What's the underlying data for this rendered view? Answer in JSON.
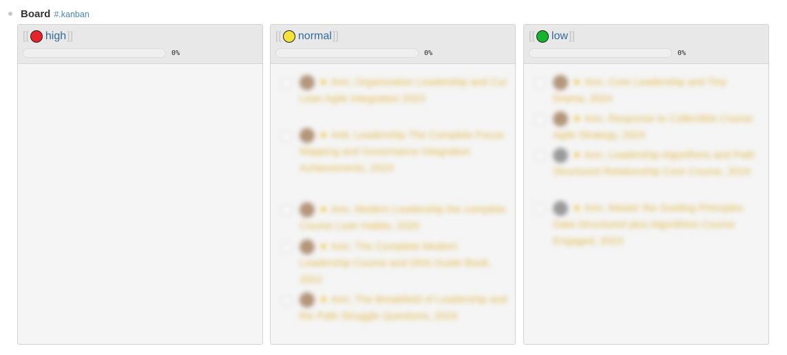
{
  "page": {
    "title": "Board",
    "tag": "#.kanban"
  },
  "columns": [
    {
      "name": "high",
      "bracket_open": "[[",
      "bracket_close": "]]",
      "dot_color": "#e8212b",
      "progress_percent": 0,
      "progress_label": "0%",
      "cards": []
    },
    {
      "name": "normal",
      "bracket_open": "[[",
      "bracket_close": "]]",
      "dot_color": "#f5e33a",
      "progress_percent": 0,
      "progress_label": "0%",
      "cards": [
        {
          "avatar": "avatar",
          "star": "★",
          "text": "Ann, Organization Leadership and Cur Lean Agile Integration 2023"
        },
        {
          "avatar": "avatar",
          "star": "★",
          "text": "Anti, Leadership The Complete Focus Mapping and Governance Integration Achievements, 2023"
        },
        {
          "avatar": "avatar",
          "star": "★",
          "text": "Ann, Modern Leadership the complete Course Lean Habits, 2020"
        },
        {
          "avatar": "avatar",
          "star": "★",
          "text": "Ann, The Complete Modern Leadership Course and DNS Guide Book, 2022"
        },
        {
          "avatar": "avatar",
          "star": "★",
          "text": "Ann, The Breakfield of Leadership and the Path Struggle Questions, 2024"
        }
      ]
    },
    {
      "name": "low",
      "bracket_open": "[[",
      "bracket_close": "]]",
      "dot_color": "#14b52d",
      "progress_percent": 0,
      "progress_label": "0%",
      "cards": [
        {
          "avatar": "avatar",
          "star": "★",
          "text": "Ann, Core Leadership and Tiny Drama, 2024"
        },
        {
          "avatar": "avatar",
          "star": "★",
          "text": "Ann, Response to Collectible Course Agile Strategy, 2024"
        },
        {
          "avatar": "avatar-grey",
          "star": "★",
          "text": "Ann, Leadership Algorithms and Path Structured Relationship Core Course, 2019"
        },
        {
          "avatar": "avatar-grey",
          "star": "★",
          "text": "Ann, Master the Guiding Principles Data-Structured plus Algorithms Course Engaged, 2023"
        }
      ]
    }
  ]
}
